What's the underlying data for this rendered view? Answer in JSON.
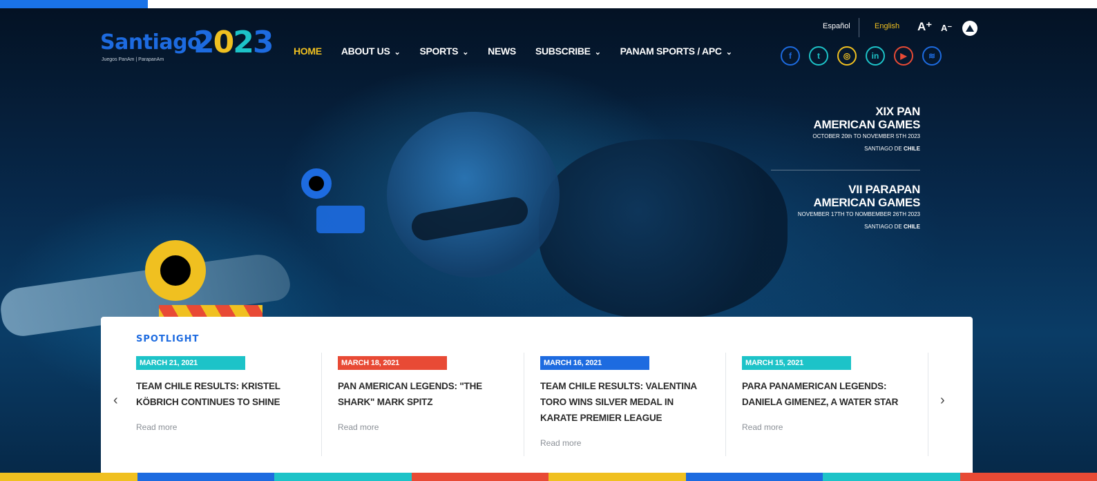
{
  "brand": {
    "word": "Santiago",
    "year_digits": [
      "2",
      "0",
      "2",
      "3"
    ],
    "tagline": "Juegos PanAm | ParapanAm"
  },
  "nav": [
    {
      "label": "HOME",
      "dropdown": false,
      "active": true
    },
    {
      "label": "ABOUT US",
      "dropdown": true,
      "active": false
    },
    {
      "label": "SPORTS",
      "dropdown": true,
      "active": false
    },
    {
      "label": "NEWS",
      "dropdown": false,
      "active": false
    },
    {
      "label": "SUBSCRIBE",
      "dropdown": true,
      "active": false
    },
    {
      "label": "PANAM SPORTS / APC",
      "dropdown": true,
      "active": false
    }
  ],
  "language": {
    "es": "Español",
    "en": "English"
  },
  "accessibility": {
    "increase": "A⁺",
    "decrease": "A⁻"
  },
  "socials": [
    {
      "name": "facebook-icon",
      "glyph": "f",
      "color": "#1d6be0"
    },
    {
      "name": "twitter-icon",
      "glyph": "t",
      "color": "#1dc3c8"
    },
    {
      "name": "instagram-icon",
      "glyph": "◎",
      "color": "#f0c020"
    },
    {
      "name": "linkedin-icon",
      "glyph": "in",
      "color": "#1dc3c8"
    },
    {
      "name": "youtube-icon",
      "glyph": "▶",
      "color": "#e84a35"
    },
    {
      "name": "spotify-icon",
      "glyph": "≋",
      "color": "#1d6be0"
    }
  ],
  "events": [
    {
      "title_line1": "XIX PAN",
      "title_line2": "AMERICAN GAMES",
      "dates": "OCTOBER 20th TO NOVEMBER 5TH 2023",
      "place_prefix": "SANTIAGO DE ",
      "place_bold": "CHILE"
    },
    {
      "title_line1": "VII PARAPAN",
      "title_line2": "AMERICAN GAMES",
      "dates": "NOVEMBER 17TH TO NOMBEMBER 26TH 2023",
      "place_prefix": "SANTIAGO DE ",
      "place_bold": "CHILE"
    }
  ],
  "spotlight": {
    "title": "SPOTLIGHT",
    "prev": "‹",
    "next": "›",
    "cards": [
      {
        "date": "MARCH 21, 2021",
        "color": "#1dc3c8",
        "title": "TEAM CHILE RESULTS: KRISTEL KÖBRICH CONTINUES TO SHINE",
        "read_more": "Read more"
      },
      {
        "date": "MARCH 18, 2021",
        "color": "#e84a35",
        "title": "PAN AMERICAN LEGENDS: \"THE SHARK\" MARK SPITZ",
        "read_more": "Read more"
      },
      {
        "date": "MARCH 16, 2021",
        "color": "#1d6be0",
        "title": "TEAM CHILE RESULTS: VALENTINA TORO WINS SILVER MEDAL IN KARATE PREMIER LEAGUE",
        "read_more": "Read more"
      },
      {
        "date": "MARCH 15, 2021",
        "color": "#1dc3c8",
        "title": "PARA PANAMERICAN LEGENDS: DANIELA GIMENEZ, A WATER STAR",
        "read_more": "Read more"
      }
    ]
  },
  "colors": {
    "blue": "#1d6be0",
    "yellow": "#f0c020",
    "teal": "#1dc3c8",
    "red": "#e84a35"
  },
  "bottom_stripes": [
    "#f0c020",
    "#1d6be0",
    "#1dc3c8",
    "#e84a35",
    "#f0c020",
    "#1d6be0",
    "#1dc3c8",
    "#e84a35"
  ]
}
